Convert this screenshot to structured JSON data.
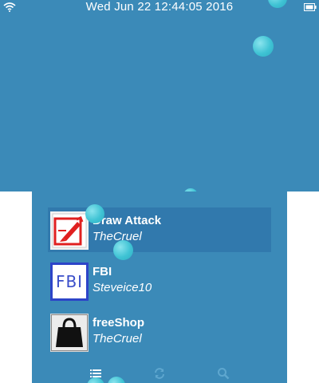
{
  "status_bar": {
    "datetime": "Wed Jun 22 12:44:05 2016",
    "wifi_icon": "wifi-icon",
    "battery_icon": "battery-icon"
  },
  "apps": [
    {
      "name": "Draw Attack",
      "author": "TheCruel",
      "icon": "draw-attack-icon",
      "selected": true
    },
    {
      "name": "FBI",
      "author": "Steveice10",
      "icon": "fbi-icon",
      "icon_text": "FBI",
      "selected": false
    },
    {
      "name": "freeShop",
      "author": "TheCruel",
      "icon": "shopping-bag-icon",
      "selected": false
    }
  ],
  "toolbar": {
    "items": [
      "list-icon",
      "refresh-icon",
      "search-icon"
    ],
    "active": "list-icon"
  },
  "colors": {
    "background": "#3b8ab8",
    "selected_row": "#3179ad",
    "bubble": "#3fc3d4"
  }
}
